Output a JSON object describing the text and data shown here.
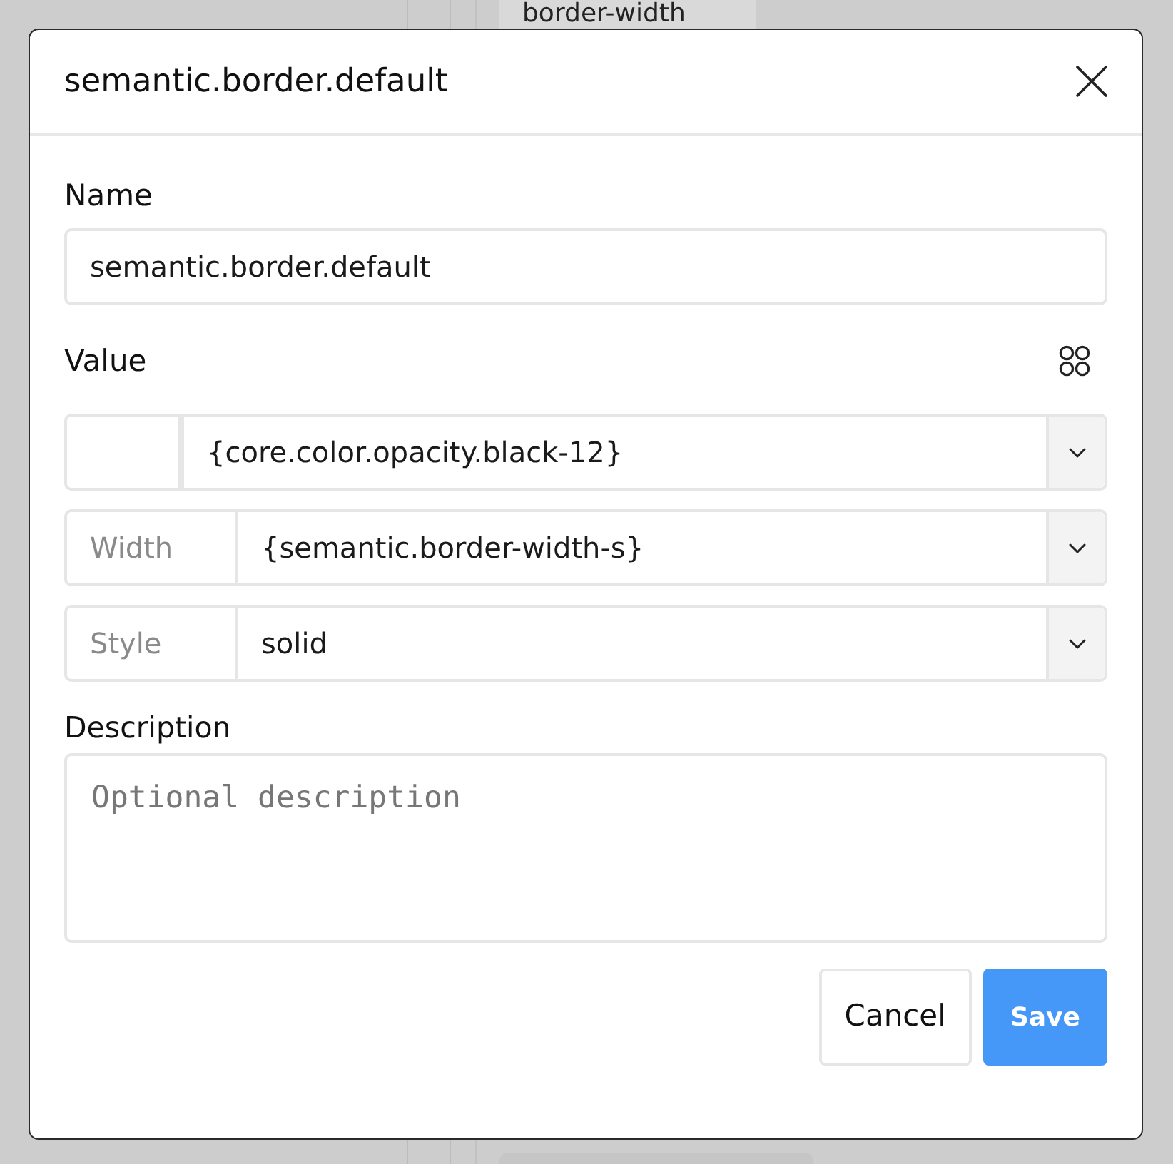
{
  "background": {
    "tab_label": "border-width"
  },
  "dialog": {
    "title": "semantic.border.default",
    "name": {
      "label": "Name",
      "value": "semantic.border.default"
    },
    "value": {
      "label": "Value",
      "rows": [
        {
          "kind": "color",
          "value": "{core.color.opacity.black-12}"
        },
        {
          "kind": "select",
          "label": "Width",
          "value": "{semantic.border-width-s}"
        },
        {
          "kind": "select",
          "label": "Style",
          "value": "solid"
        }
      ]
    },
    "description": {
      "label": "Description",
      "placeholder": "Optional description"
    },
    "buttons": [
      {
        "label": "Cancel",
        "kind": "secondary"
      },
      {
        "label": "Save",
        "kind": "primary"
      }
    ]
  }
}
